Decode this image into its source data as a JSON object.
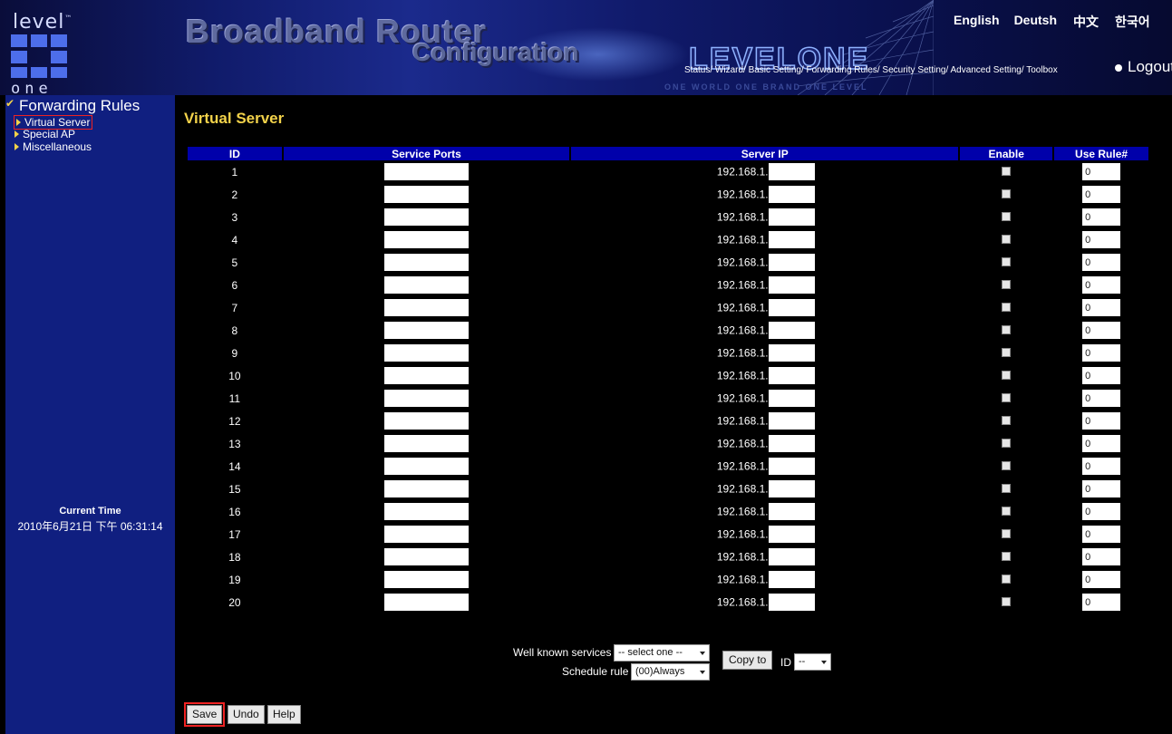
{
  "banner": {
    "logo_level": "level",
    "logo_tm": "™",
    "logo_one": "one",
    "title": "Broadband Router",
    "subtitle": "Configuration",
    "brand": "LEVELONE",
    "slogan": "ONE WORLD  ONE BRAND  ONE LEVEL",
    "languages": [
      "English",
      "Deutsh",
      "中文",
      "한국어"
    ],
    "nav": "Status/ Wizard/ Basic Setting/ Forwarding Rules/ Security Setting/ Advanced Setting/ Toolbox",
    "logout": "Logout"
  },
  "sidebar": {
    "section": "Forwarding Rules",
    "items": [
      {
        "label": "Virtual Server",
        "active": true
      },
      {
        "label": "Special AP",
        "active": false
      },
      {
        "label": "Miscellaneous",
        "active": false
      }
    ],
    "time_label": "Current Time",
    "time_value": "2010年6月21日 下午 06:31:14"
  },
  "main": {
    "title": "Virtual Server",
    "columns": [
      "ID",
      "Service Ports",
      "Server IP",
      "Enable",
      "Use Rule#"
    ],
    "ip_prefix": "192.168.1.",
    "rows": [
      {
        "id": "1",
        "rule": "0"
      },
      {
        "id": "2",
        "rule": "0"
      },
      {
        "id": "3",
        "rule": "0"
      },
      {
        "id": "4",
        "rule": "0"
      },
      {
        "id": "5",
        "rule": "0"
      },
      {
        "id": "6",
        "rule": "0"
      },
      {
        "id": "7",
        "rule": "0"
      },
      {
        "id": "8",
        "rule": "0"
      },
      {
        "id": "9",
        "rule": "0"
      },
      {
        "id": "10",
        "rule": "0"
      },
      {
        "id": "11",
        "rule": "0"
      },
      {
        "id": "12",
        "rule": "0"
      },
      {
        "id": "13",
        "rule": "0"
      },
      {
        "id": "14",
        "rule": "0"
      },
      {
        "id": "15",
        "rule": "0"
      },
      {
        "id": "16",
        "rule": "0"
      },
      {
        "id": "17",
        "rule": "0"
      },
      {
        "id": "18",
        "rule": "0"
      },
      {
        "id": "19",
        "rule": "0"
      },
      {
        "id": "20",
        "rule": "0"
      }
    ]
  },
  "controls": {
    "well_known_label": "Well known services",
    "well_known_value": "-- select one --",
    "schedule_label": "Schedule rule",
    "schedule_value": "(00)Always",
    "copy_to": "Copy to",
    "id_label": "ID",
    "id_value": "--",
    "save": "Save",
    "undo": "Undo",
    "help": "Help"
  },
  "colors": {
    "header_bg": "#0000aa",
    "sidebar_bg": "#101f80",
    "title_accent": "#f2d24a",
    "active_outline": "#e22222"
  }
}
